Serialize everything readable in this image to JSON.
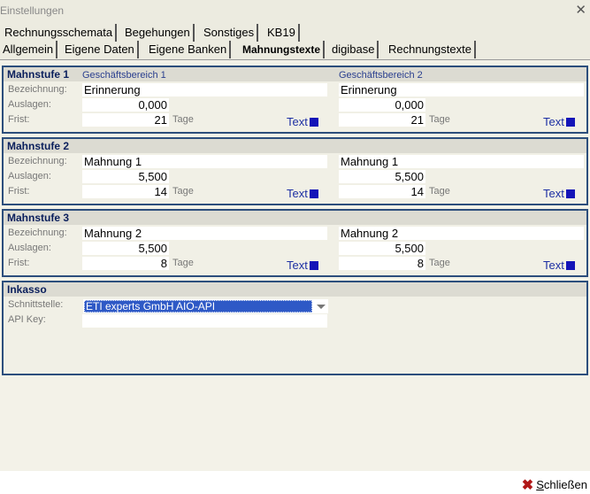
{
  "window": {
    "title": "Einstellungen"
  },
  "tabs_row1": [
    "Rechnungsschemata",
    "Begehungen",
    "Sonstiges",
    "KB19"
  ],
  "tabs_row2": [
    "Allgemein",
    "Eigene Daten",
    "Eigene Banken",
    "Mahnungstexte",
    "digibase",
    "Rechnungstexte"
  ],
  "active_tab": "Mahnungstexte",
  "labels": {
    "bezeichnung": "Bezeichnung:",
    "auslagen": "Auslagen:",
    "frist": "Frist:",
    "tage": "Tage",
    "text_button": "Text",
    "gb1": "Geschäftsbereich 1",
    "gb2": "Geschäftsbereich 2"
  },
  "mahnstufen": [
    {
      "title": "Mahnstufe 1",
      "gb1": {
        "bezeichnung": "Erinnerung",
        "auslagen": "0,000",
        "frist": "21"
      },
      "gb2": {
        "bezeichnung": "Erinnerung",
        "auslagen": "0,000",
        "frist": "21"
      }
    },
    {
      "title": "Mahnstufe 2",
      "gb1": {
        "bezeichnung": "Mahnung 1",
        "auslagen": "5,500",
        "frist": "14"
      },
      "gb2": {
        "bezeichnung": "Mahnung 1",
        "auslagen": "5,500",
        "frist": "14"
      }
    },
    {
      "title": "Mahnstufe 3",
      "gb1": {
        "bezeichnung": "Mahnung 2",
        "auslagen": "5,500",
        "frist": "8"
      },
      "gb2": {
        "bezeichnung": "Mahnung 2",
        "auslagen": "5,500",
        "frist": "8"
      }
    }
  ],
  "inkasso": {
    "title": "Inkasso",
    "schnittstelle_label": "Schnittstelle:",
    "schnittstelle_value": "ETI experts GmbH AIO-API",
    "api_key_label": "API Key:",
    "api_key_value": ""
  },
  "footer": {
    "close_label_underlined": "S",
    "close_label_rest": "chließen"
  },
  "colors": {
    "section_border": "#2c4e7c",
    "text_square": "#1414b8",
    "selection": "#2e59c6"
  }
}
